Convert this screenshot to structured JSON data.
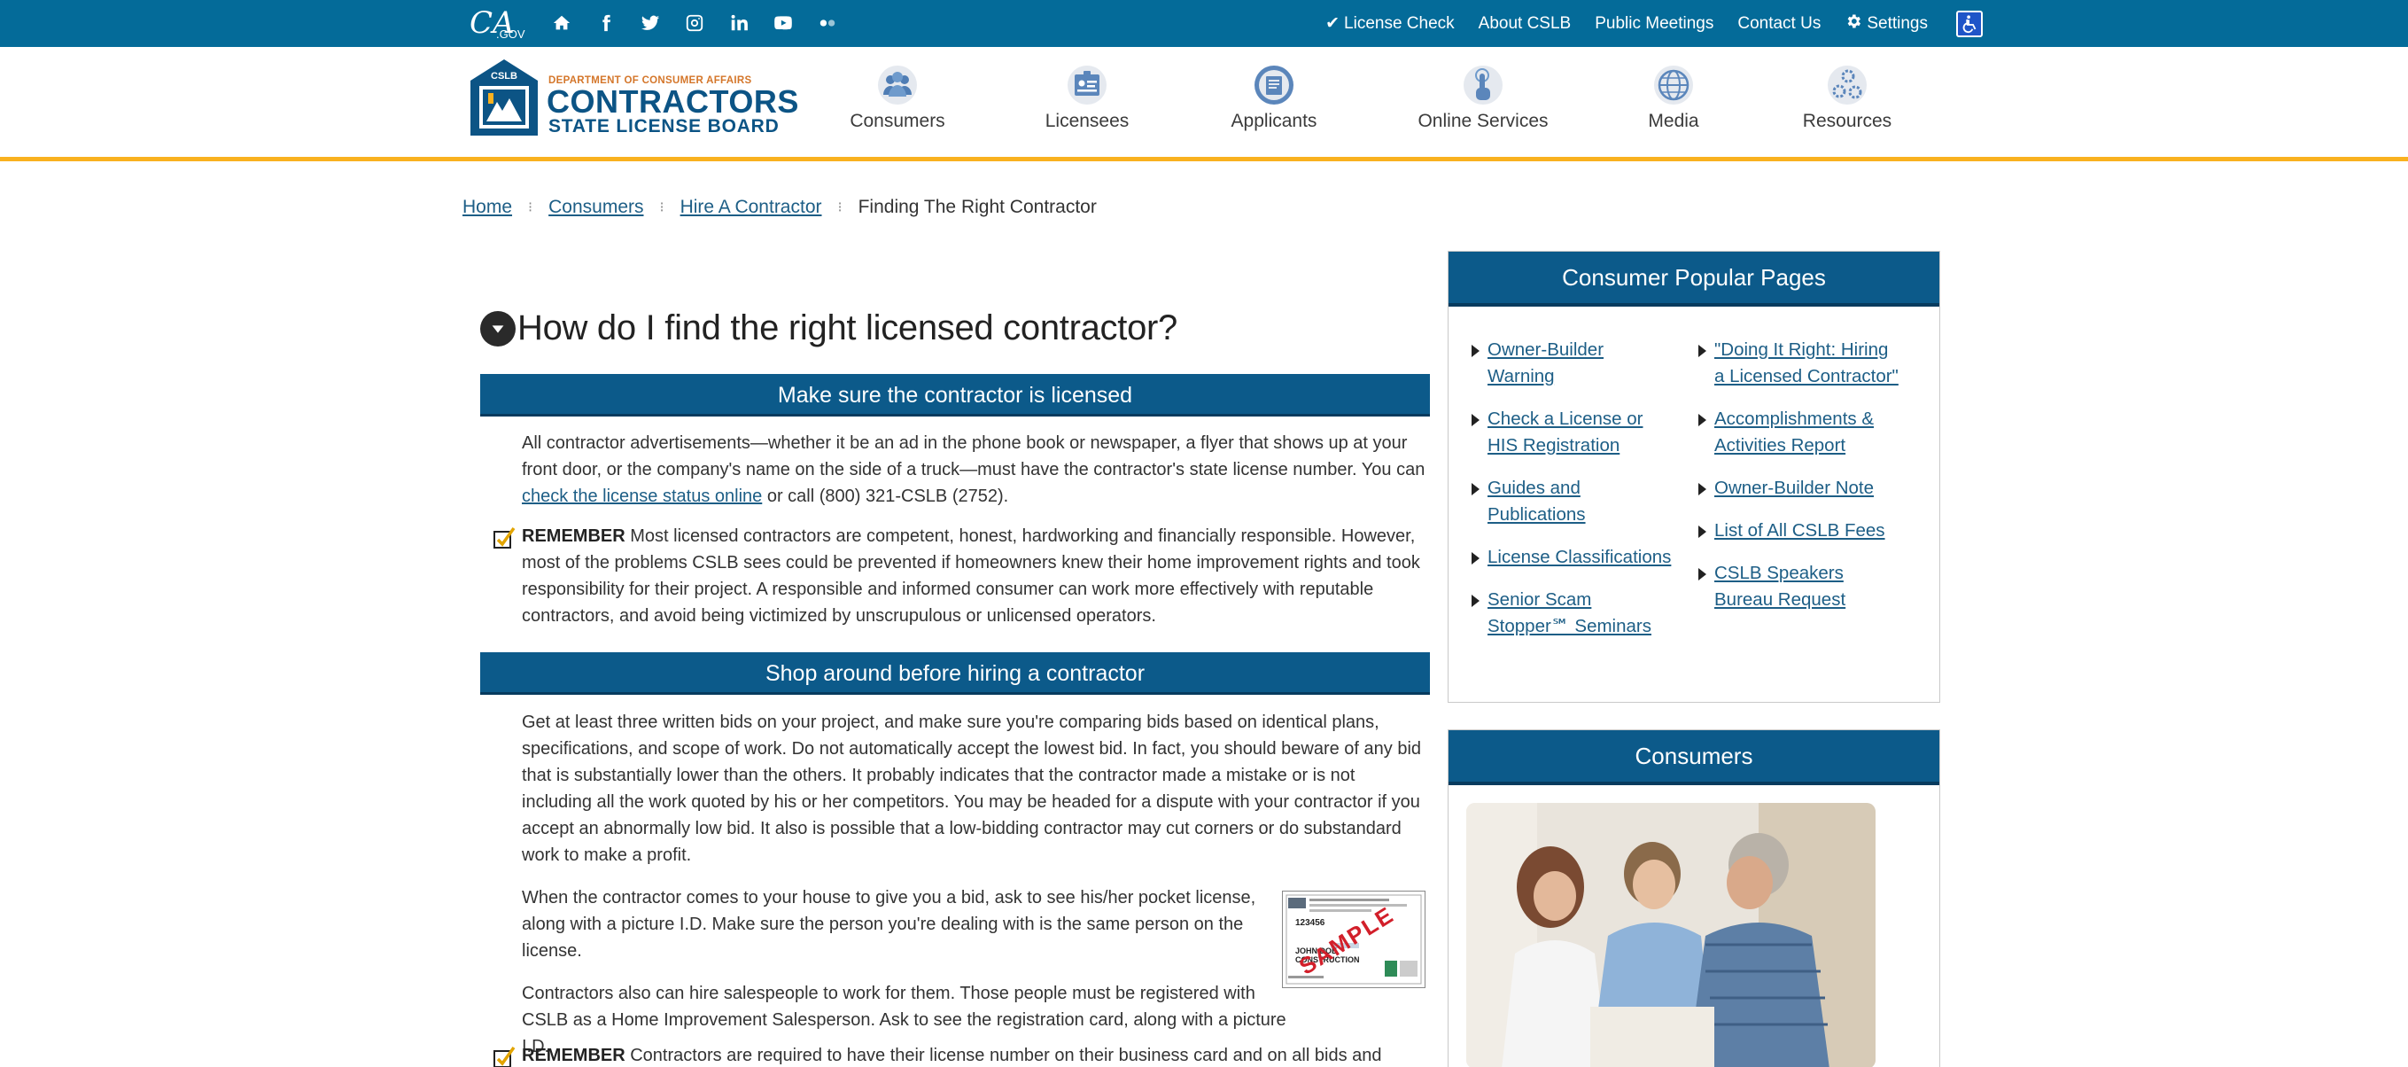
{
  "topbar": {
    "logo_text": "CA",
    "logo_sub": ".GOV",
    "social": [
      "home-icon",
      "facebook-icon",
      "twitter-icon",
      "instagram-icon",
      "linkedin-icon",
      "youtube-icon",
      "flickr-icon"
    ],
    "links": {
      "license_check": "License Check",
      "about": "About CSLB",
      "public_meetings": "Public Meetings",
      "contact": "Contact Us",
      "settings": "Settings"
    },
    "check_glyph": "✔"
  },
  "logo": {
    "dept": "DEPARTMENT OF CONSUMER AFFAIRS",
    "main": "CONTRACTORS",
    "sub": "STATE LICENSE BOARD",
    "emblem_text": "CSLB"
  },
  "nav": [
    {
      "label": "Consumers",
      "icon": "people-icon"
    },
    {
      "label": "Licensees",
      "icon": "id-card-icon"
    },
    {
      "label": "Applicants",
      "icon": "form-icon"
    },
    {
      "label": "Online Services",
      "icon": "touch-icon"
    },
    {
      "label": "Media",
      "icon": "globe-icon"
    },
    {
      "label": "Resources",
      "icon": "gears-icon"
    }
  ],
  "breadcrumb": {
    "home": "Home",
    "consumers": "Consumers",
    "hire": "Hire A Contractor",
    "current": "Finding The Right Contractor",
    "sep": "⁝"
  },
  "content": {
    "title": "How do I find the right licensed contractor?",
    "band1": "Make sure the contractor is licensed",
    "p1_a": "All contractor advertisements—whether it be an ad in the phone book or newspaper, a flyer that shows up at your front door, or the company's name on the side of a truck—must have the contractor's state license number. You can ",
    "p1_link": "check the license status online",
    "p1_b": " or call (800) 321-CSLB (2752).",
    "remember_label": "REMEMBER",
    "p2": " Most licensed contractors are competent, honest, hardworking and financially responsible. However, most of the problems CSLB sees could be prevented if homeowners knew their home improvement rights and took responsibility for their project. A responsible and informed consumer can work more effectively with reputable contractors, and avoid being victimized by unscrupulous or unlicensed operators.",
    "band2": "Shop around before hiring a contractor",
    "p3": "Get at least three written bids on your project, and make sure you're comparing bids based on identical plans, specifications, and scope of work. Do not automatically accept the lowest bid. In fact, you should beware of any bid that is substantially lower than the others. It probably indicates that the contractor made a mistake or is not including all the work quoted by his or her competitors. You may be headed for a dispute with your contractor if you accept an abnormally low bid. It also is possible that a low-bidding contractor may cut corners or do substandard work to make a profit.",
    "p4": "When the contractor comes to your house to give you a bid, ask to see his/her pocket license, along with a picture I.D. Make sure the person you're dealing with is the same person on the license.",
    "p5": "Contractors also can hire salespeople to work for them. Those people must be registered with CSLB as a Home Improvement Salesperson. Ask to see the registration card, along with a picture I.D.",
    "p6": " Contractors are required to have their license number on their business card and on all bids and",
    "card_sample": "SAMPLE",
    "card_number": "123456",
    "card_name_1": "JOHN DOE",
    "card_name_2": "CONSTRUCTION"
  },
  "sidebar": {
    "popular_title": "Consumer Popular Pages",
    "popular_left": [
      "Owner-Builder Warning",
      "Check a License or HIS Registration",
      "Guides and Publications",
      "License Classifications",
      "Senior Scam Stopper℠ Seminars"
    ],
    "popular_right": [
      "\"Doing It Right: Hiring a Licensed Contractor\"",
      "Accomplishments & Activities Report",
      "Owner-Builder Note",
      "List of All CSLB Fees",
      "CSLB Speakers Bureau Request"
    ],
    "consumers_title": "Consumers"
  },
  "colors": {
    "topbar": "#046b99",
    "band": "#0c5a8a",
    "accent_line": "#f9b11f",
    "link": "#1d5e86"
  }
}
